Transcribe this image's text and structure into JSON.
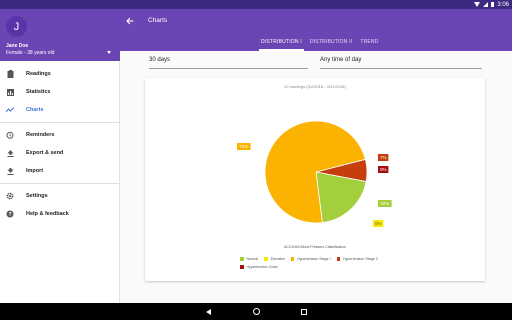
{
  "status_bar": {
    "time": "3:06"
  },
  "drawer": {
    "avatar_letter": "J",
    "user_name": "Jane Doe",
    "user_sub": "Female - 38 years old",
    "items": [
      {
        "label": "Readings",
        "icon": "clipboard-icon"
      },
      {
        "label": "Statistics",
        "icon": "statistics-icon"
      },
      {
        "label": "Charts",
        "icon": "chart-line-icon",
        "active": true
      },
      {
        "label": "Reminders",
        "icon": "alarm-icon"
      },
      {
        "label": "Export & send",
        "icon": "upload-icon"
      },
      {
        "label": "Import",
        "icon": "download-icon"
      },
      {
        "label": "Settings",
        "icon": "gear-icon"
      },
      {
        "label": "Help & feedback",
        "icon": "help-icon"
      }
    ]
  },
  "appbar": {
    "title": "Charts",
    "tabs": [
      "DISTRIBUTION I",
      "DISTRIBUTION II",
      "TREND"
    ],
    "active_tab": 0
  },
  "filters": {
    "range": "30 days",
    "time": "Any time of day"
  },
  "card": {
    "subtitle": "20 readings (3/2/2018 - 3/31/2018)"
  },
  "chart_data": {
    "type": "pie",
    "title": "ACC/AHA Blood Pressure Classification",
    "series": [
      {
        "name": "Normal",
        "value": 20,
        "label": "20%",
        "color": "#a4cf3c"
      },
      {
        "name": "Elevated",
        "value": 0,
        "label": "0%",
        "color": "#f5e900"
      },
      {
        "name": "Hypertension Stage I",
        "value": 73,
        "label": "73%",
        "color": "#fbb200"
      },
      {
        "name": "Hypertension Stage 2",
        "value": 7,
        "label": "7%",
        "color": "#c53e0c"
      },
      {
        "name": "Hypertension Crisis",
        "value": 0,
        "label": "0%",
        "color": "#a50e0e"
      }
    ],
    "legend_placement": "bottom"
  },
  "colors": {
    "primary": "#6a45b4",
    "status_bar": "#3c2a80",
    "accent": "#3f73d6"
  }
}
